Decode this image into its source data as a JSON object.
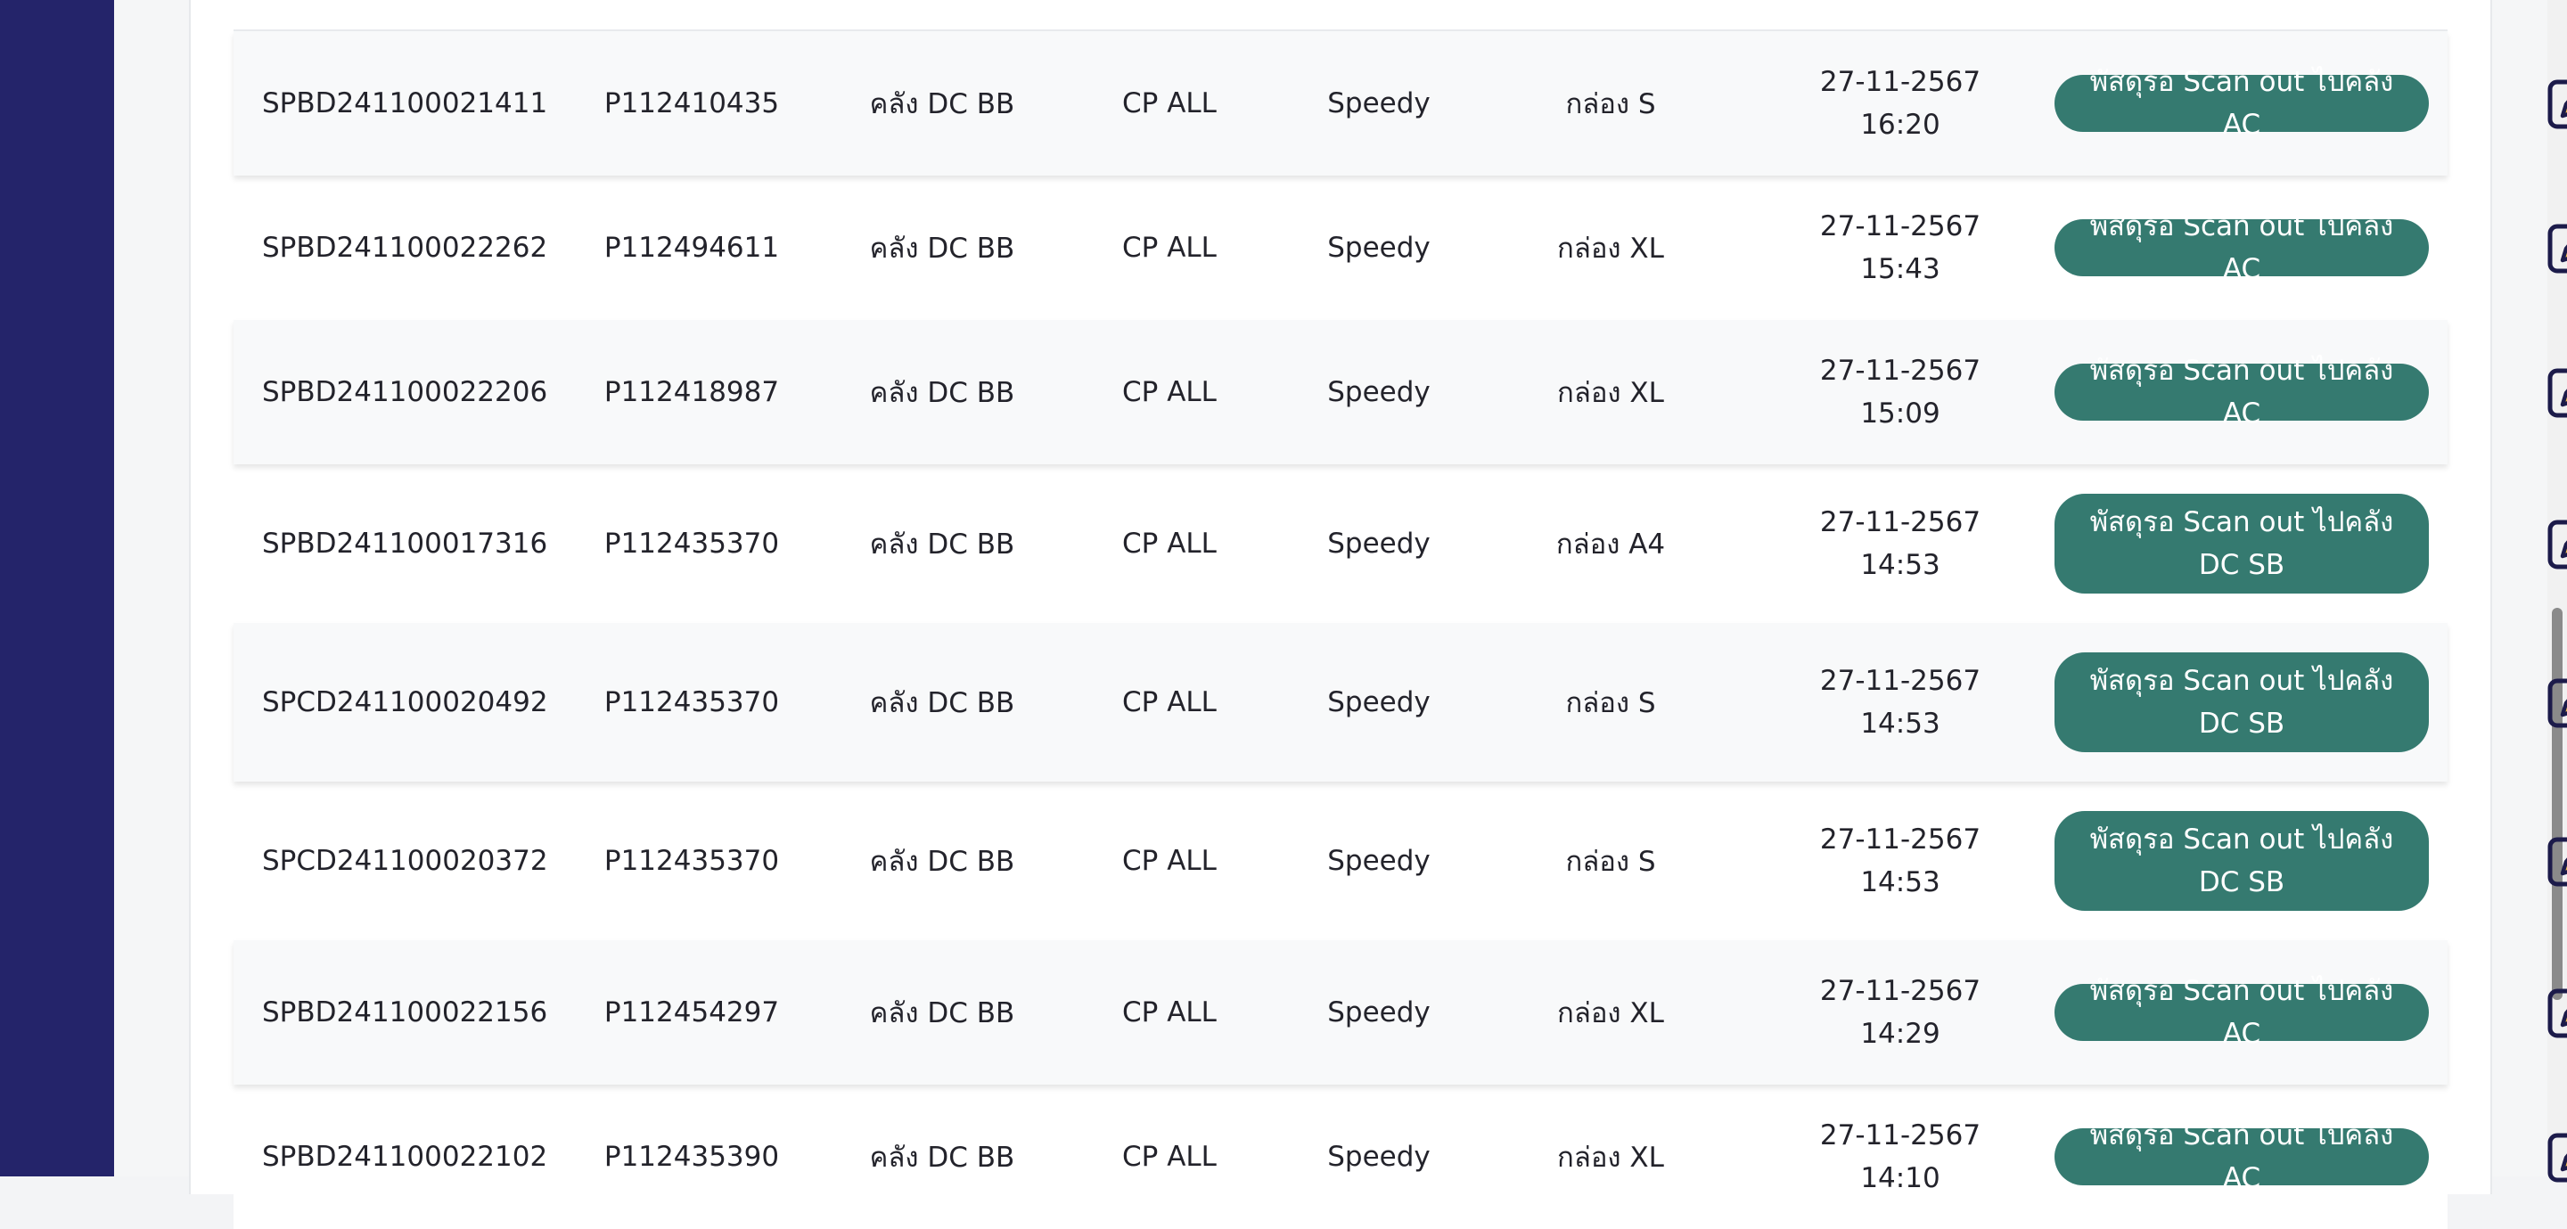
{
  "table": {
    "rows": [
      {
        "code": "SPBD241100021411",
        "po": "P112410435",
        "warehouse": "คลัง DC BB",
        "customer": "CP ALL",
        "carrier": "Speedy",
        "box": "กล่อง S",
        "date": "27-11-2567",
        "time": "16:20",
        "status": "พัสดุรอ Scan out ไปคลัง AC"
      },
      {
        "code": "SPBD241100022262",
        "po": "P112494611",
        "warehouse": "คลัง DC BB",
        "customer": "CP ALL",
        "carrier": "Speedy",
        "box": "กล่อง XL",
        "date": "27-11-2567",
        "time": "15:43",
        "status": "พัสดุรอ Scan out ไปคลัง AC"
      },
      {
        "code": "SPBD241100022206",
        "po": "P112418987",
        "warehouse": "คลัง DC BB",
        "customer": "CP ALL",
        "carrier": "Speedy",
        "box": "กล่อง XL",
        "date": "27-11-2567",
        "time": "15:09",
        "status": "พัสดุรอ Scan out ไปคลัง AC"
      },
      {
        "code": "SPBD241100017316",
        "po": "P112435370",
        "warehouse": "คลัง DC BB",
        "customer": "CP ALL",
        "carrier": "Speedy",
        "box": "กล่อง A4",
        "date": "27-11-2567",
        "time": "14:53",
        "status": "พัสดุรอ Scan out ไปคลัง DC SB"
      },
      {
        "code": "SPCD241100020492",
        "po": "P112435370",
        "warehouse": "คลัง DC BB",
        "customer": "CP ALL",
        "carrier": "Speedy",
        "box": "กล่อง S",
        "date": "27-11-2567",
        "time": "14:53",
        "status": "พัสดุรอ Scan out ไปคลัง DC SB"
      },
      {
        "code": "SPCD241100020372",
        "po": "P112435370",
        "warehouse": "คลัง DC BB",
        "customer": "CP ALL",
        "carrier": "Speedy",
        "box": "กล่อง S",
        "date": "27-11-2567",
        "time": "14:53",
        "status": "พัสดุรอ Scan out ไปคลัง DC SB"
      },
      {
        "code": "SPBD241100022156",
        "po": "P112454297",
        "warehouse": "คลัง DC BB",
        "customer": "CP ALL",
        "carrier": "Speedy",
        "box": "กล่อง XL",
        "date": "27-11-2567",
        "time": "14:29",
        "status": "พัสดุรอ Scan out ไปคลัง AC"
      },
      {
        "code": "SPBD241100022102",
        "po": "P112435390",
        "warehouse": "คลัง DC BB",
        "customer": "CP ALL",
        "carrier": "Speedy",
        "box": "กล่อง XL",
        "date": "27-11-2567",
        "time": "14:10",
        "status": "พัสดุรอ Scan out ไปคลัง AC"
      }
    ]
  },
  "colors": {
    "sidebar": "#24246a",
    "status_badge": "#357a70",
    "edit_icon_fill": "#f2c14e",
    "edit_icon_stroke": "#1c1b4a"
  },
  "icons": {
    "row_action": "edit-icon"
  }
}
